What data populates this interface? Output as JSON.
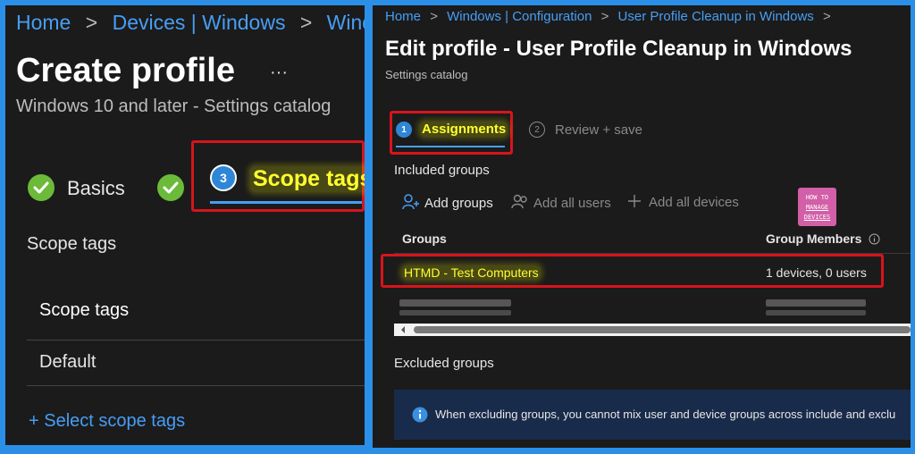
{
  "left": {
    "breadcrumb": [
      "Home",
      "Devices | Windows",
      "Windo"
    ],
    "title": "Create profile",
    "more": "···",
    "subtitle": "Windows 10 and later - Settings catalog",
    "steps": [
      {
        "label": "Basics",
        "state": "complete"
      },
      {
        "label": "",
        "state": "complete"
      },
      {
        "number": "3",
        "label": "Scope tags",
        "state": "current"
      }
    ],
    "section_heading": "Scope tags",
    "table": {
      "header": "Scope tags",
      "rows": [
        "Default"
      ]
    },
    "select_link": "+ Select scope tags"
  },
  "right": {
    "breadcrumb": [
      "Home",
      "Windows | Configuration",
      "User Profile Cleanup in Windows"
    ],
    "title": "Edit profile - User Profile Cleanup in Windows",
    "subtitle": "Settings catalog",
    "tabs": [
      {
        "number": "1",
        "label": "Assignments",
        "state": "active"
      },
      {
        "number": "2",
        "label": "Review + save",
        "state": "inactive"
      }
    ],
    "included_heading": "Included groups",
    "actions": {
      "add_groups": "Add groups",
      "add_all_users": "Add all users",
      "add_all_devices": "Add all devices"
    },
    "logo": {
      "line1": "HOW TO",
      "line2": "MANAGE",
      "line3": "DEVICES"
    },
    "table": {
      "columns": [
        "Groups",
        "Group Members"
      ],
      "rows": [
        {
          "group": "HTMD - Test Computers",
          "members": "1 devices, 0 users"
        }
      ]
    },
    "excluded_heading": "Excluded groups",
    "info_text": "When excluding groups, you cannot mix user and device groups across include and exclu"
  },
  "colors": {
    "accent": "#479ef5",
    "highlight_box": "#d7141c",
    "highlight_text": "#ffff2e",
    "check_green": "#6cba3a",
    "frame": "#2b8fe8"
  }
}
